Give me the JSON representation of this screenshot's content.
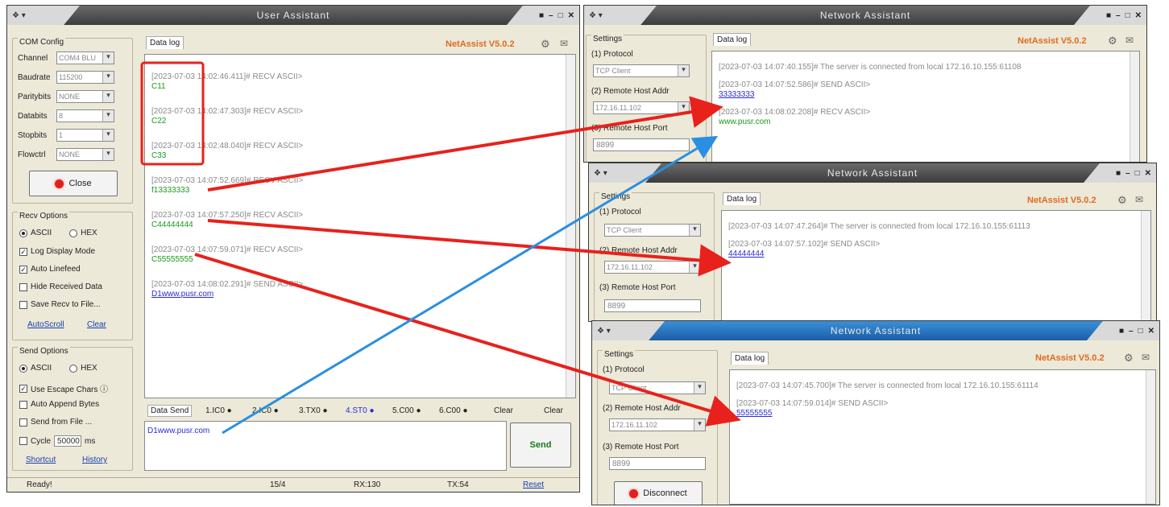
{
  "left": {
    "title": "User Assistant",
    "title_icon": "❖ ▾",
    "win_controls": [
      "■",
      "–",
      "□",
      "✕"
    ],
    "com": {
      "label": "COM Config",
      "rows": [
        {
          "label": "Channel",
          "value": "COM4 BLU"
        },
        {
          "label": "Baudrate",
          "value": "115200"
        },
        {
          "label": "Paritybits",
          "value": "NONE"
        },
        {
          "label": "Databits",
          "value": "8"
        },
        {
          "label": "Stopbits",
          "value": "1"
        },
        {
          "label": "Flowctrl",
          "value": "NONE"
        }
      ],
      "close_label": "Close"
    },
    "recv": {
      "label": "Recv Options",
      "ascii": "ASCII",
      "hex": "HEX",
      "checks": [
        {
          "label": "Log Display Mode",
          "checked": true
        },
        {
          "label": "Auto Linefeed",
          "checked": true
        },
        {
          "label": "Hide Received Data",
          "checked": false
        },
        {
          "label": "Save Recv to File...",
          "checked": false
        }
      ],
      "autoscroll": "AutoScroll",
      "clear": "Clear"
    },
    "send": {
      "label": "Send Options",
      "ascii": "ASCII",
      "hex": "HEX",
      "checks": [
        {
          "label": "Use Escape Chars ⓘ",
          "checked": true
        },
        {
          "label": "Auto Append Bytes",
          "checked": false
        },
        {
          "label": "Send from File ...",
          "checked": false
        }
      ],
      "cycle_label": "Cycle",
      "cycle_value": "50000",
      "cycle_unit": "ms",
      "shortcut": "Shortcut",
      "history": "History"
    },
    "log": {
      "tab": "Data log",
      "brand": "NetAssist V5.0.2",
      "entries": [
        {
          "header": "[2023-07-03 14:02:46.411]# RECV ASCII>",
          "data": "C11",
          "color": "green"
        },
        {
          "header": "[2023-07-03 14:02:47.303]# RECV ASCII>",
          "data": "C22",
          "color": "green"
        },
        {
          "header": "[2023-07-03 14:02:48.040]# RECV ASCII>",
          "data": "C33",
          "color": "green"
        },
        {
          "header": "[2023-07-03 14:07:52.669]# RECV ASCII>",
          "data": "f13333333",
          "color": "green"
        },
        {
          "header": "[2023-07-03 14:07:57.250]# RECV ASCII>",
          "data": "C44444444",
          "color": "green"
        },
        {
          "header": "[2023-07-03 14:07:59.071]# RECV ASCII>",
          "data": "C55555555",
          "color": "green"
        },
        {
          "header": "[2023-07-03 14:08:02.291]# SEND ASCII>",
          "data": "D1www.pusr.com",
          "color": "blue"
        }
      ]
    },
    "sendbar": {
      "tab": "Data Send",
      "slots": [
        "1.IC0 ●",
        "2.IC0 ●",
        "3.TX0 ●",
        "4.ST0 ●",
        "5.C00 ●",
        "6.C00 ●"
      ],
      "clear1": "Clear",
      "clear2": "Clear",
      "text": "D1www.pusr.com",
      "send": "Send"
    },
    "status": {
      "ready": "Ready!",
      "count": "15/4",
      "rx": "RX:130",
      "tx": "TX:54",
      "reset": "Reset"
    }
  },
  "net1": {
    "title": "Network Assistant",
    "settings": "Settings",
    "protocol_label": "(1) Protocol",
    "protocol": "TCP Client",
    "addr_label": "(2) Remote Host Addr",
    "addr": "172.16.11.102",
    "port_label": "(3) Remote Host Port",
    "port": "8899",
    "tab": "Data log",
    "brand": "NetAssist V5.0.2",
    "lines": [
      {
        "text": "[2023-07-03 14:07:40.155]# The server is connected from local 172.16.10.155:61108",
        "kind": "header"
      },
      {
        "text": "[2023-07-03 14:07:52.586]# SEND ASCII>",
        "kind": "header"
      },
      {
        "text": "33333333",
        "kind": "blue"
      },
      {
        "text": "[2023-07-03 14:08:02.208]# RECV ASCII>",
        "kind": "header"
      },
      {
        "text": "www.pusr.com",
        "kind": "green"
      }
    ]
  },
  "net2": {
    "title": "Network Assistant",
    "settings": "Settings",
    "protocol_label": "(1) Protocol",
    "protocol": "TCP Client",
    "addr_label": "(2) Remote Host Addr",
    "addr": "172.16.11.102",
    "port_label": "(3) Remote Host Port",
    "port": "8899",
    "tab": "Data log",
    "brand": "NetAssist V5.0.2",
    "lines": [
      {
        "text": "[2023-07-03 14:07:47.264]# The server is connected from local 172.16.10.155:61113",
        "kind": "header"
      },
      {
        "text": "[2023-07-03 14:07:57.102]# SEND ASCII>",
        "kind": "header"
      },
      {
        "text": "44444444",
        "kind": "blue"
      }
    ]
  },
  "net3": {
    "title": "Network Assistant",
    "settings": "Settings",
    "protocol_label": "(1) Protocol",
    "protocol": "TCP Client",
    "addr_label": "(2) Remote Host Addr",
    "addr": "172.16.11.102",
    "port_label": "(3) Remote Host Port",
    "port": "8899",
    "tab": "Data log",
    "brand": "NetAssist V5.0.2",
    "disconnect": "Disconnect",
    "lines": [
      {
        "text": "[2023-07-03 14:07:45.700]# The server is connected from local 172.16.10.155:61114",
        "kind": "header"
      },
      {
        "text": "[2023-07-03 14:07:59.014]# SEND ASCII>",
        "kind": "header"
      },
      {
        "text": "55555555",
        "kind": "blue"
      }
    ]
  },
  "colors": {
    "arrow_red": "#e8211c",
    "arrow_blue": "#2a8fe0",
    "highlight_box": "#e8211c",
    "brand_orange": "#e06a20"
  }
}
